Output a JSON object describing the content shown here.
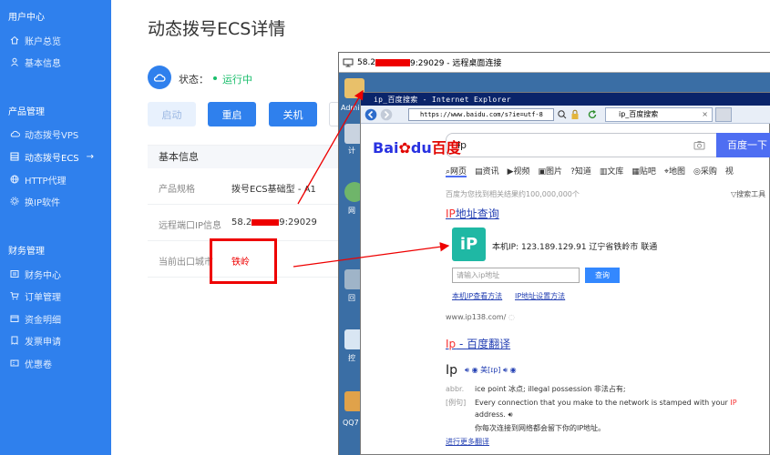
{
  "sidebar": {
    "user_center": "用户中心",
    "items_user": [
      {
        "label": "账户总览",
        "icon": "home-icon"
      },
      {
        "label": "基本信息",
        "icon": "user-icon"
      }
    ],
    "product_mgmt": "产品管理",
    "items_product": [
      {
        "label": "动态拨号VPS",
        "icon": "cloud-icon"
      },
      {
        "label": "动态拨号ECS",
        "icon": "server-icon",
        "active": true,
        "arrow": "→"
      },
      {
        "label": "HTTP代理",
        "icon": "globe-icon"
      },
      {
        "label": "换IP软件",
        "icon": "gear-icon"
      }
    ],
    "finance_mgmt": "财务管理",
    "items_finance": [
      {
        "label": "财务中心",
        "icon": "finance-icon"
      },
      {
        "label": "订单管理",
        "icon": "cart-icon"
      },
      {
        "label": "资金明细",
        "icon": "wallet-icon"
      },
      {
        "label": "发票申请",
        "icon": "invoice-icon"
      },
      {
        "label": "优惠卷",
        "icon": "coupon-icon"
      }
    ]
  },
  "main": {
    "title": "动态拨号ECS详情",
    "status_label": "状态：",
    "status_value": "运行中",
    "buttons": {
      "start": "启动",
      "restart": "重启",
      "shutdown": "关机"
    },
    "info_header": "基本信息",
    "rows": [
      {
        "label": "产品规格",
        "value": "拨号ECS基础型 - A1"
      },
      {
        "label": "远程端口IP信息",
        "value_pre": "58.2",
        "value_post": "9:29029"
      },
      {
        "label": "当前出口城市",
        "value": "铁岭"
      }
    ]
  },
  "remote_desktop": {
    "title_pre": "58.2",
    "title_post": "9:29029 - 远程桌面连接",
    "desktop_labels": [
      "Admin",
      "计",
      "网",
      "回",
      "控",
      "QQ7"
    ]
  },
  "browser": {
    "window_title": "ip_百度搜索 - Internet Explorer",
    "address": "https://www.baidu.com/s?ie=utf-8",
    "tab_title": "ip_百度搜索",
    "tab_close": "×",
    "logo_bai": "Bai",
    "logo_du": "du",
    "logo_cn": "百度",
    "query": "ip",
    "search_button": "百度一下",
    "tabs": [
      "网页",
      "资讯",
      "视频",
      "图片",
      "知道",
      "文库",
      "贴吧",
      "地图",
      "采购",
      "视"
    ],
    "result_count": "百度为您找到相关结果约100,000,000个",
    "search_tools": "搜索工具",
    "result1_hl": "IP",
    "result1_title": "地址查询",
    "ip_logo_text": "iP",
    "ip_info": "本机IP: 123.189.129.91   辽宁省铁岭市 联通",
    "ip_input_placeholder": "请输入ip地址",
    "ip_query_button": "查询",
    "link1": "本机IP查看方法",
    "link2": "IP地址设置方法",
    "site": "www.ip138.com/",
    "result2_hl": "Ip",
    "result2_title": " - 百度翻译",
    "tr_word": "Ip",
    "tr_phonetic": "美[ɪp]",
    "tr_abbr_tag": "abbr.",
    "tr_abbr": "ice point 冰点; illegal possession 非法占有;",
    "tr_example_tag": "[例句]",
    "tr_example_pre": "Every connection that you make to the network is stamped with your ",
    "tr_example_hl": "IP",
    "tr_example_post": "address.",
    "tr_example_cn": "你每次连接到网络都会留下你的IP地址。",
    "tr_more": "进行更多翻译"
  },
  "colors": {
    "sidebar": "#2f80ed",
    "accent": "#2f80ed",
    "running": "#19be6b",
    "annotation": "#e00000"
  }
}
